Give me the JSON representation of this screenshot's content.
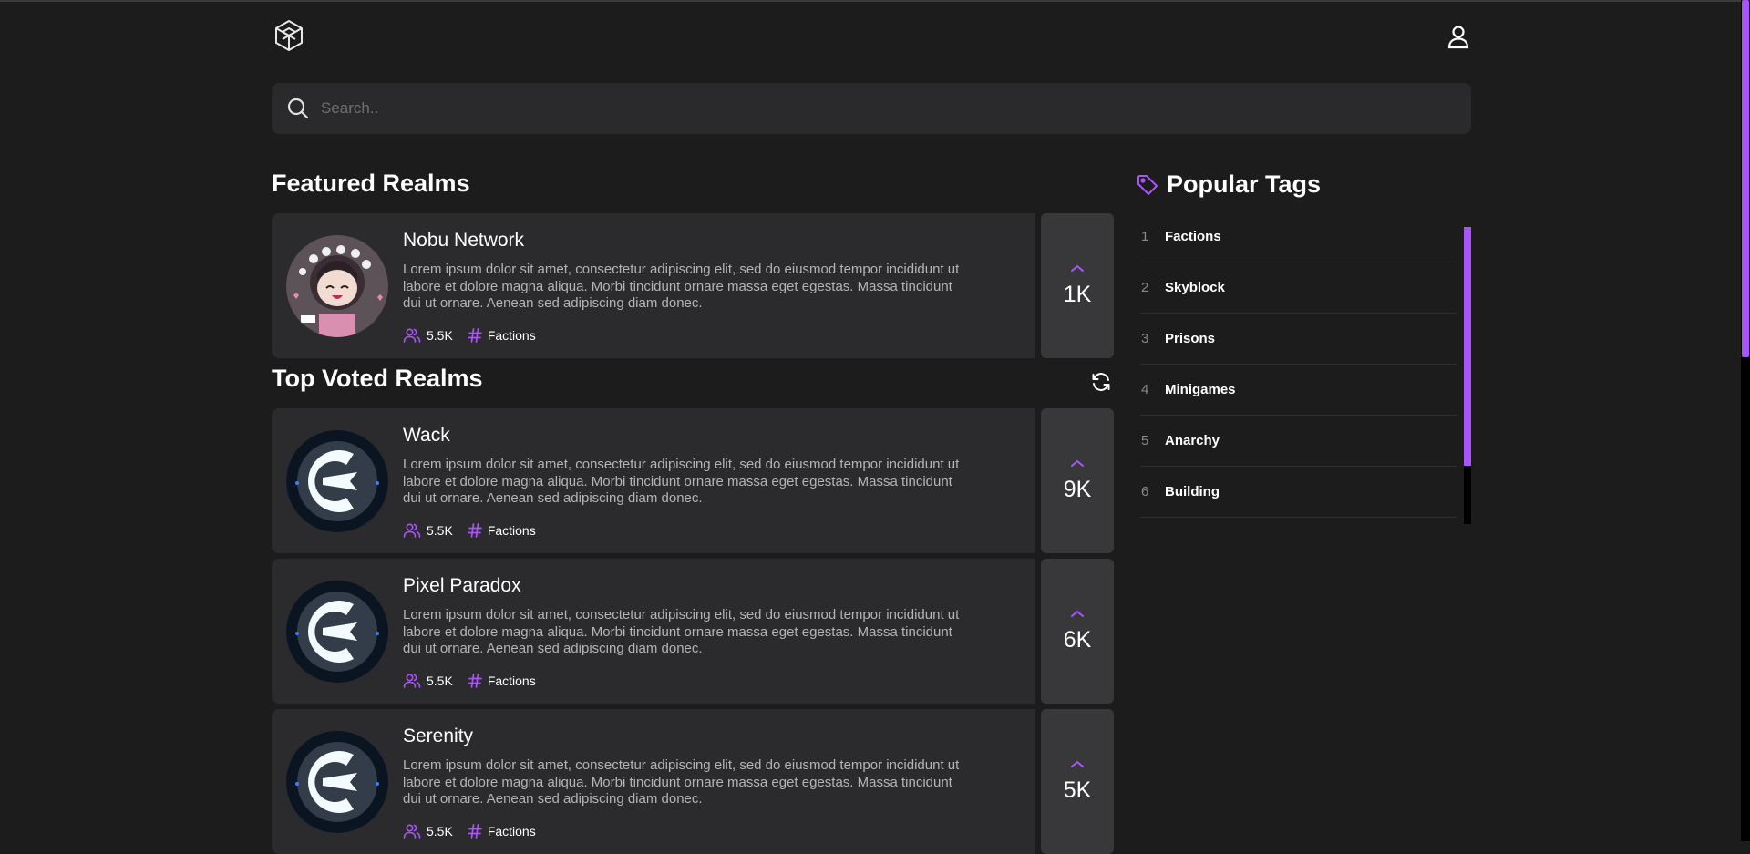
{
  "header": {
    "logo_icon": "cube-logo-icon",
    "user_icon": "user-icon"
  },
  "search": {
    "placeholder": "Search.."
  },
  "featured": {
    "title": "Featured Realms",
    "realms": [
      {
        "name": "Nobu Network",
        "description": "Lorem ipsum dolor sit amet, consectetur adipiscing elit, sed do eiusmod tempor incididunt ut labore et dolore magna aliqua. Morbi tincidunt ornare massa eget egestas. Massa tincidunt dui ut ornare. Aenean sed adipiscing diam donec.",
        "players": "5.5K",
        "tag": "Factions",
        "votes": "1K",
        "avatar": "anime-avatar"
      }
    ]
  },
  "top_voted": {
    "title": "Top Voted Realms",
    "refresh_icon": "refresh-icon",
    "realms": [
      {
        "name": "Wack",
        "description": "Lorem ipsum dolor sit amet, consectetur adipiscing elit, sed do eiusmod tempor incididunt ut labore et dolore magna aliqua. Morbi tincidunt ornare massa eget egestas. Massa tincidunt dui ut ornare. Aenean sed adipiscing diam donec.",
        "players": "5.5K",
        "tag": "Factions",
        "votes": "9K",
        "avatar": "e-logo-avatar"
      },
      {
        "name": "Pixel Paradox",
        "description": "Lorem ipsum dolor sit amet, consectetur adipiscing elit, sed do eiusmod tempor incididunt ut labore et dolore magna aliqua. Morbi tincidunt ornare massa eget egestas. Massa tincidunt dui ut ornare. Aenean sed adipiscing diam donec.",
        "players": "5.5K",
        "tag": "Factions",
        "votes": "6K",
        "avatar": "e-logo-avatar"
      },
      {
        "name": "Serenity",
        "description": "Lorem ipsum dolor sit amet, consectetur adipiscing elit, sed do eiusmod tempor incididunt ut labore et dolore magna aliqua. Morbi tincidunt ornare massa eget egestas. Massa tincidunt dui ut ornare. Aenean sed adipiscing diam donec.",
        "players": "5.5K",
        "tag": "Factions",
        "votes": "5K",
        "avatar": "e-logo-avatar"
      }
    ]
  },
  "popular_tags": {
    "title": "Popular Tags",
    "icon": "tag-icon",
    "items": [
      {
        "rank": "1",
        "name": "Factions"
      },
      {
        "rank": "2",
        "name": "Skyblock"
      },
      {
        "rank": "3",
        "name": "Prisons"
      },
      {
        "rank": "4",
        "name": "Minigames"
      },
      {
        "rank": "5",
        "name": "Anarchy"
      },
      {
        "rank": "6",
        "name": "Building"
      }
    ]
  },
  "colors": {
    "accent": "#a855f7",
    "background": "#1c1c1d",
    "card": "#2b2b2d",
    "vote_box": "#38383b"
  }
}
